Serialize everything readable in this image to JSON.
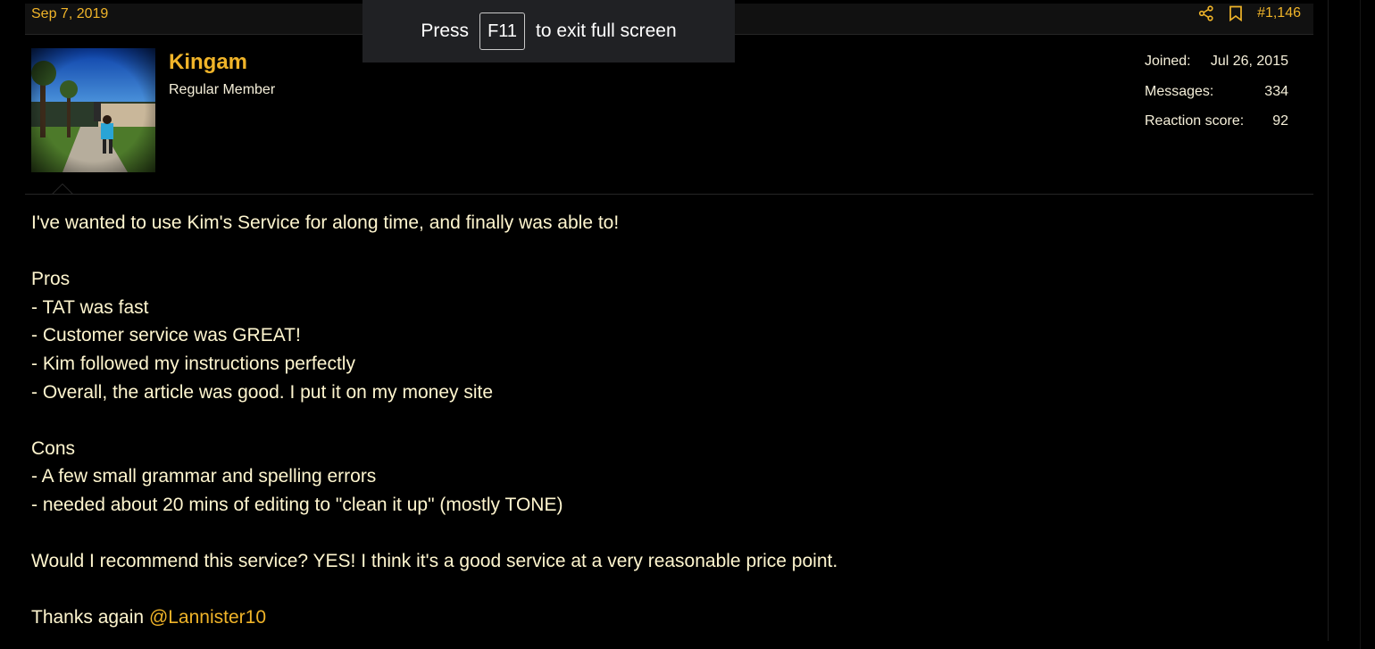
{
  "post": {
    "date": "Sep 7, 2019",
    "number": "#1,146",
    "share_icon": "share-icon",
    "bookmark_icon": "bookmark-icon"
  },
  "fullscreen": {
    "press": "Press",
    "key": "F11",
    "rest": "to exit full screen"
  },
  "user": {
    "name": "Kingam",
    "title": "Regular Member",
    "joined_label": "Joined:",
    "joined_value": "Jul 26, 2015",
    "messages_label": "Messages:",
    "messages_value": "334",
    "reaction_label": "Reaction score:",
    "reaction_value": "92"
  },
  "message": {
    "intro": "I've wanted to use Kim's Service for along time, and finally was able to!",
    "pros_heading": "Pros",
    "pros": [
      "- TAT was fast",
      "- Customer service was GREAT!",
      "- Kim followed my instructions perfectly",
      "- Overall, the article was good. I put it on my money site"
    ],
    "cons_heading": "Cons",
    "cons": [
      "- A few small grammar and spelling errors",
      "- needed about 20 mins of editing to \"clean it up\" (mostly TONE)"
    ],
    "recommend": "Would I recommend this service? YES! I think it's a good service at a very reasonable price point.",
    "thanks": "Thanks again",
    "mention": "@Lannister10"
  },
  "colors": {
    "accent": "#f0b429",
    "text": "#fff6cf",
    "background": "#000000"
  }
}
